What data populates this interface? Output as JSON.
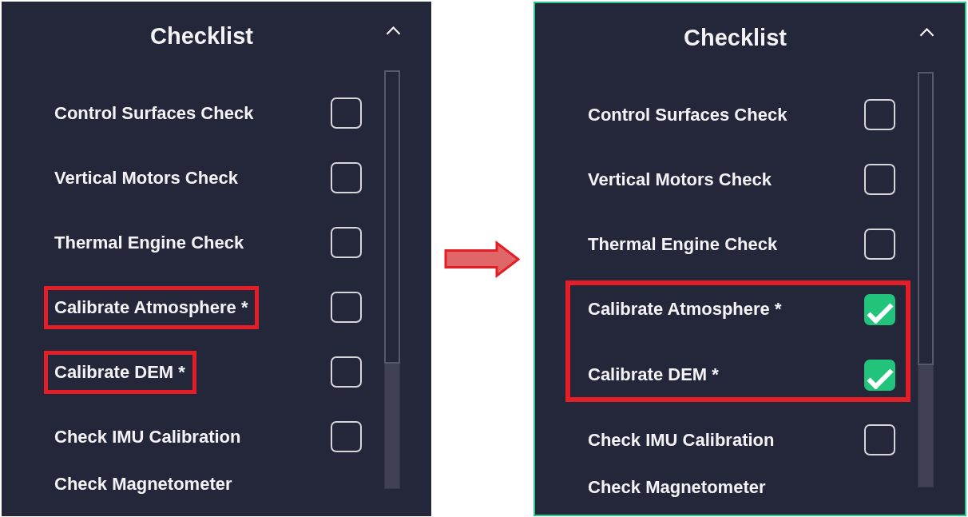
{
  "panels": [
    {
      "title": "Checklist",
      "expanded": true,
      "focused": false,
      "kind": "labels",
      "items": [
        {
          "kind": "row",
          "label": "Control Surfaces Check",
          "checked": false,
          "highlighted": false
        },
        {
          "kind": "row",
          "label": "Vertical Motors Check",
          "checked": false,
          "highlighted": false
        },
        {
          "kind": "row",
          "label": "Thermal Engine Check",
          "checked": false,
          "highlighted": false
        },
        {
          "kind": "row",
          "label": "Calibrate Atmosphere *",
          "checked": false,
          "highlighted": true
        },
        {
          "kind": "row",
          "label": "Calibrate DEM *",
          "checked": false,
          "highlighted": true
        },
        {
          "kind": "row",
          "label": "Check IMU Calibration",
          "checked": false,
          "highlighted": false
        },
        {
          "kind": "partial",
          "label": "Check Magnetometer"
        }
      ]
    },
    {
      "title": "Checklist",
      "expanded": true,
      "focused": true,
      "kind": "rows",
      "items": [
        {
          "kind": "row",
          "label": "Control Surfaces Check",
          "checked": false,
          "highlighted": false
        },
        {
          "kind": "row",
          "label": "Vertical Motors Check",
          "checked": false,
          "highlighted": false
        },
        {
          "kind": "row",
          "label": "Thermal Engine Check",
          "checked": false,
          "highlighted": false
        },
        {
          "kind": "row",
          "label": "Calibrate Atmosphere *",
          "checked": true,
          "highlighted": true
        },
        {
          "kind": "row",
          "label": "Calibrate DEM *",
          "checked": true,
          "highlighted": true
        },
        {
          "kind": "row",
          "label": "Check IMU Calibration",
          "checked": false,
          "highlighted": false
        },
        {
          "kind": "partial",
          "label": "Check Magnetometer"
        }
      ]
    }
  ]
}
